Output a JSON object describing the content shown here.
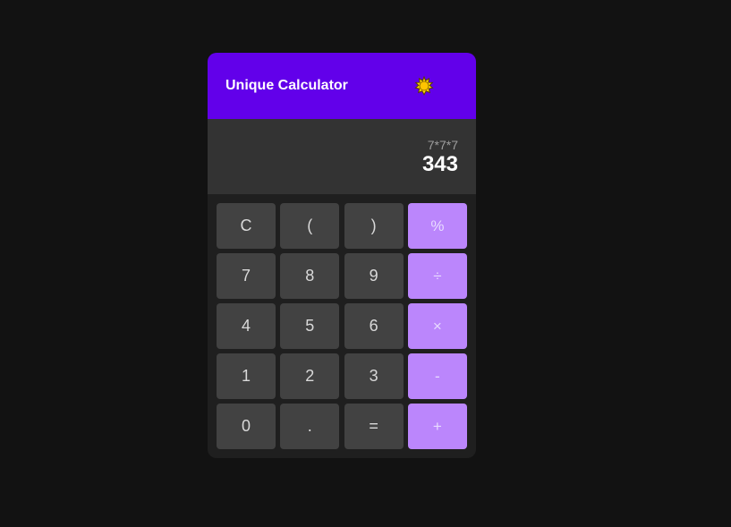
{
  "header": {
    "title": "Unique Calculator",
    "theme_icon": "sun-icon",
    "accent_color": "#6200ea"
  },
  "display": {
    "expression": "7*7*7",
    "result": "343"
  },
  "keypad": {
    "operator_color": "#bb86fc",
    "rows": [
      [
        {
          "label": "C",
          "name": "clear-button",
          "type": "fn"
        },
        {
          "label": "(",
          "name": "open-paren-button",
          "type": "fn"
        },
        {
          "label": ")",
          "name": "close-paren-button",
          "type": "fn"
        },
        {
          "label": "%",
          "name": "percent-button",
          "type": "op"
        }
      ],
      [
        {
          "label": "7",
          "name": "digit-7-button",
          "type": "fn"
        },
        {
          "label": "8",
          "name": "digit-8-button",
          "type": "fn"
        },
        {
          "label": "9",
          "name": "digit-9-button",
          "type": "fn"
        },
        {
          "label": "÷",
          "name": "divide-button",
          "type": "op"
        }
      ],
      [
        {
          "label": "4",
          "name": "digit-4-button",
          "type": "fn"
        },
        {
          "label": "5",
          "name": "digit-5-button",
          "type": "fn"
        },
        {
          "label": "6",
          "name": "digit-6-button",
          "type": "fn"
        },
        {
          "label": "×",
          "name": "multiply-button",
          "type": "op"
        }
      ],
      [
        {
          "label": "1",
          "name": "digit-1-button",
          "type": "fn"
        },
        {
          "label": "2",
          "name": "digit-2-button",
          "type": "fn"
        },
        {
          "label": "3",
          "name": "digit-3-button",
          "type": "fn"
        },
        {
          "label": "-",
          "name": "subtract-button",
          "type": "op"
        }
      ],
      [
        {
          "label": "0",
          "name": "digit-0-button",
          "type": "fn"
        },
        {
          "label": ".",
          "name": "decimal-button",
          "type": "fn"
        },
        {
          "label": "=",
          "name": "equals-button",
          "type": "fn"
        },
        {
          "label": "+",
          "name": "add-button",
          "type": "op"
        }
      ]
    ]
  }
}
